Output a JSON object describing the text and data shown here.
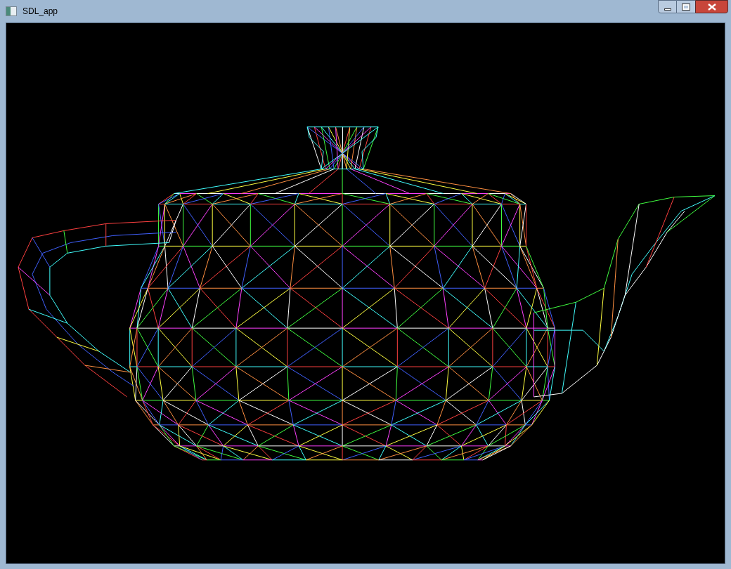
{
  "window": {
    "title": "SDL_app"
  }
}
